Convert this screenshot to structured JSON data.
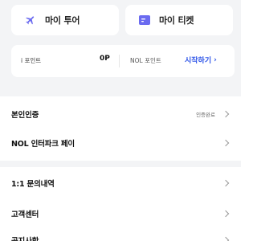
{
  "shortcuts": {
    "my_tour": "마이 투어",
    "my_ticket": "마이 티켓"
  },
  "points": {
    "i_point_label": "i 포인트",
    "i_point_value": "0P",
    "nol_point_label": "NOL 포인트",
    "start_link": "시작하기"
  },
  "menu": {
    "verification": {
      "label": "본인인증",
      "status": "인증완료"
    },
    "nol_pay": {
      "label": "NOL 인터파크 페이"
    },
    "inquiry": {
      "label": "1:1 문의내역"
    },
    "customer_center": {
      "label": "고객센터"
    },
    "notice": {
      "label": "공지사항"
    }
  },
  "colors": {
    "accent": "#2e55e8",
    "icon_purple": "#6b6bf0",
    "background_gray": "#f3f4f6"
  }
}
